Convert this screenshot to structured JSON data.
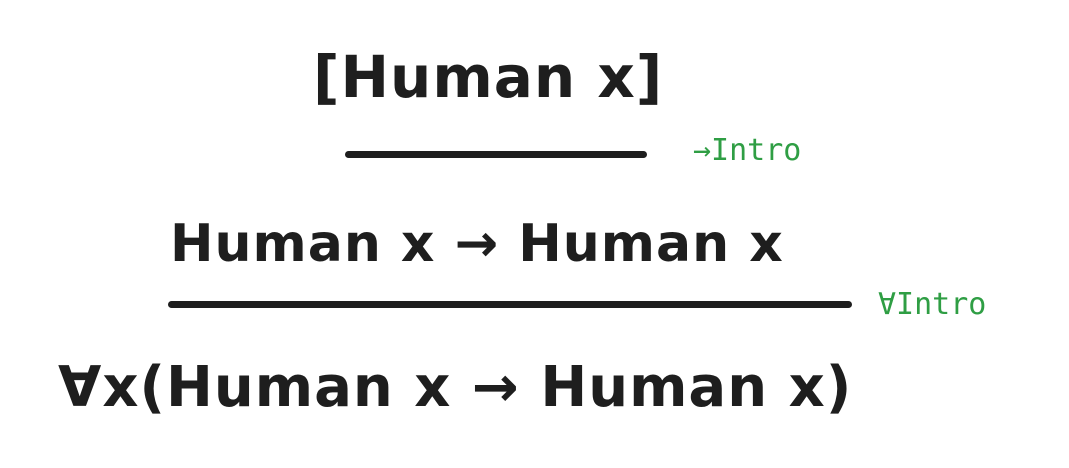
{
  "proof": {
    "assumption": "[Human x]",
    "first_rule": "→Intro",
    "implication": "Human x → Human x",
    "second_rule": "∀Intro",
    "conclusion": "∀x(Human x → Human x)"
  },
  "colors": {
    "ink": "#1e1e1e",
    "rule_label": "#2f9e44"
  }
}
